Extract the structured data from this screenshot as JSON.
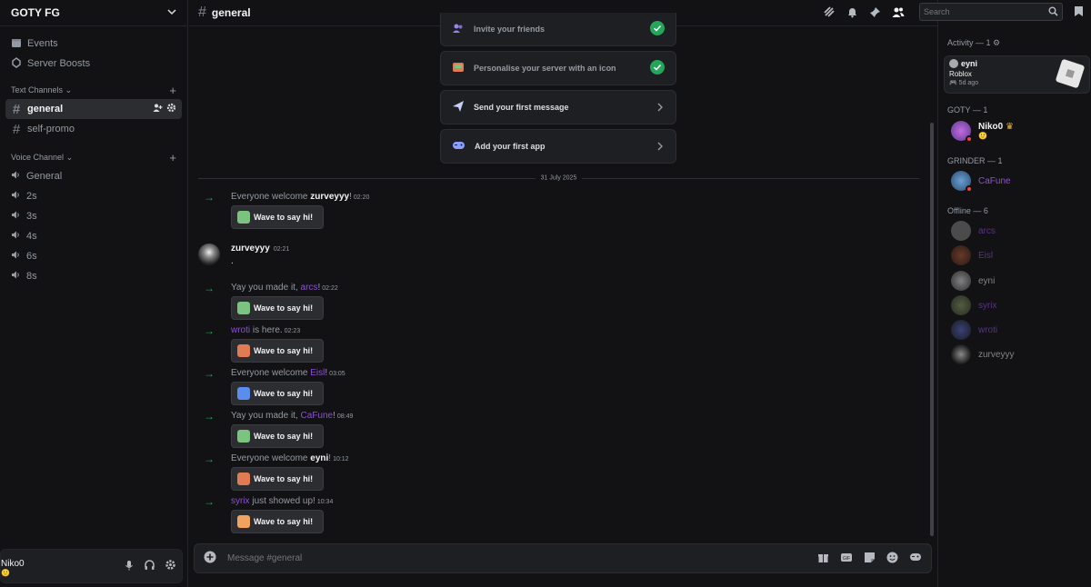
{
  "server": {
    "name": "GOTY FG"
  },
  "sidebar": {
    "top_items": [
      {
        "label": "Events"
      },
      {
        "label": "Server Boosts"
      }
    ],
    "text_category": "Text Channels",
    "text_channels": [
      {
        "name": "general"
      },
      {
        "name": "self-promo"
      }
    ],
    "voice_category": "Voice Channel",
    "voice_channels": [
      {
        "name": "General"
      },
      {
        "name": "2s"
      },
      {
        "name": "3s"
      },
      {
        "name": "4s"
      },
      {
        "name": "6s"
      },
      {
        "name": "8s"
      }
    ]
  },
  "user": {
    "name": "Niko0",
    "status_emoji": "🙂"
  },
  "channel": {
    "name": "general"
  },
  "search": {
    "placeholder": "Search"
  },
  "setup_cards": [
    {
      "label": "Invite your friends",
      "done": true
    },
    {
      "label": "Personalise your server with an icon",
      "done": true
    },
    {
      "label": "Send your first message",
      "done": false
    },
    {
      "label": "Add your first app",
      "done": false
    }
  ],
  "date_divider": "31 July 2025",
  "messages": [
    {
      "pre": "Everyone welcome ",
      "name": "zurveyyy",
      "post": "!",
      "time": "02:20",
      "name_color": "#f2f3f5",
      "wave": "Wave to say hi!",
      "sticker_color": "#7ac47f"
    },
    {
      "author": "zurveyyy",
      "time": "02:21",
      "text": "."
    },
    {
      "pre": "Yay you made it, ",
      "name": "arcs",
      "post": "!",
      "time": "02:22",
      "name_color": "#8f4fd6",
      "wave": "Wave to say hi!",
      "sticker_color": "#7ac47f"
    },
    {
      "pre": "",
      "name": "wroti",
      "post": " is here.",
      "time": "02:23",
      "name_color": "#8f4fd6",
      "wave": "Wave to say hi!",
      "sticker_color": "#e07b53"
    },
    {
      "pre": "Everyone welcome ",
      "name": "Eisl",
      "post": "!",
      "time": "03:05",
      "name_color": "#8f4fd6",
      "wave": "Wave to say hi!",
      "sticker_color": "#5b8def"
    },
    {
      "pre": "Yay you made it, ",
      "name": "CaFune",
      "post": "!",
      "time": "08:49",
      "name_color": "#8f4fd6",
      "wave": "Wave to say hi!",
      "sticker_color": "#7ac47f"
    },
    {
      "pre": "Everyone welcome ",
      "name": "eyni",
      "post": "!",
      "time": "10:12",
      "name_color": "#f2f3f5",
      "wave": "Wave to say hi!",
      "sticker_color": "#e07b53"
    },
    {
      "pre": "",
      "name": "syrix",
      "post": " just showed up!",
      "time": "10:34",
      "name_color": "#8f4fd6",
      "wave": "Wave to say hi!",
      "sticker_color": "#f0a35e"
    }
  ],
  "composer": {
    "placeholder": "Message #general"
  },
  "members": {
    "activity_header": "Activity — 1",
    "activity": {
      "name": "eyni",
      "game": "Roblox",
      "time": "5d ago"
    },
    "groups": [
      {
        "header": "GOTY — 1",
        "members": [
          {
            "name": "Niko0",
            "crown": "♛",
            "status": "🙂",
            "color": "#f2f3f5"
          }
        ]
      },
      {
        "header": "GRINDER — 1",
        "members": [
          {
            "name": "CaFune",
            "color": "#8f4fd6"
          }
        ]
      },
      {
        "header": "Offline — 6",
        "members": [
          {
            "name": "arcs",
            "color": "#8f4fd6"
          },
          {
            "name": "Eisl",
            "color": "#8f4fd6"
          },
          {
            "name": "eyni",
            "color": "#dbdee1"
          },
          {
            "name": "syrix",
            "color": "#8f4fd6"
          },
          {
            "name": "wroti",
            "color": "#8f4fd6"
          },
          {
            "name": "zurveyyy",
            "color": "#dbdee1"
          }
        ]
      }
    ]
  },
  "colors": {
    "accent_green": "#23a55a",
    "purple_name": "#8f4fd6",
    "background": "#121214"
  }
}
